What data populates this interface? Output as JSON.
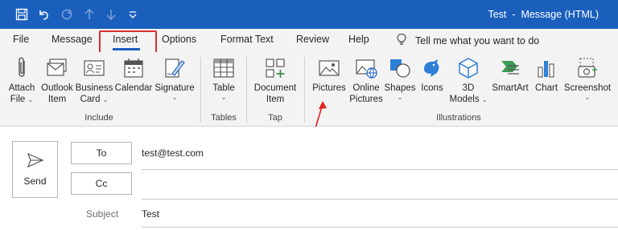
{
  "window": {
    "title": "Test  -  Message (HTML)"
  },
  "qat": {
    "icons": [
      "save-icon",
      "undo-icon",
      "redo-icon",
      "up-arrow-icon",
      "down-arrow-icon",
      "customize-qat-icon"
    ]
  },
  "tabs": [
    {
      "label": "File"
    },
    {
      "label": "Message"
    },
    {
      "label": "Insert"
    },
    {
      "label": "Options"
    },
    {
      "label": "Format Text"
    },
    {
      "label": "Review"
    },
    {
      "label": "Help"
    }
  ],
  "tell_me": {
    "text": "Tell me what you want to do"
  },
  "ribbon": {
    "include": {
      "label": "Include",
      "buttons": [
        {
          "l1": "Attach",
          "l2": "File",
          "caret": "⌄"
        },
        {
          "l1": "Outlook",
          "l2": "Item"
        },
        {
          "l1": "Business",
          "l2": "Card",
          "caret": "⌄"
        },
        {
          "l1": "Calendar",
          "l2": ""
        },
        {
          "l1": "Signature",
          "l2": "",
          "caret": "⌄"
        }
      ]
    },
    "tables": {
      "label": "Tables",
      "buttons": [
        {
          "l1": "Table",
          "l2": "",
          "caret": "⌄"
        }
      ]
    },
    "tap": {
      "label": "Tap",
      "buttons": [
        {
          "l1": "Document",
          "l2": "Item"
        }
      ]
    },
    "illustrations": {
      "label": "Illustrations",
      "buttons": [
        {
          "l1": "Pictures",
          "l2": ""
        },
        {
          "l1": "Online",
          "l2": "Pictures"
        },
        {
          "l1": "Shapes",
          "l2": "",
          "caret": "⌄"
        },
        {
          "l1": "Icons",
          "l2": ""
        },
        {
          "l1": "3D",
          "l2": "Models",
          "caret": "⌄"
        },
        {
          "l1": "SmartArt",
          "l2": ""
        },
        {
          "l1": "Chart",
          "l2": ""
        },
        {
          "l1": "Screenshot",
          "l2": "",
          "caret": "⌄"
        }
      ]
    }
  },
  "compose": {
    "send_label": "Send",
    "to_label": "To",
    "to_value": "test@test.com",
    "cc_label": "Cc",
    "cc_value": "",
    "subject_label": "Subject",
    "subject_value": "Test"
  },
  "colors": {
    "titlebar": "#1b5fbd",
    "ribbon_bg": "#f3f3f3",
    "highlight_box": "#d72d32",
    "annotation_arrow": "#e02020"
  }
}
